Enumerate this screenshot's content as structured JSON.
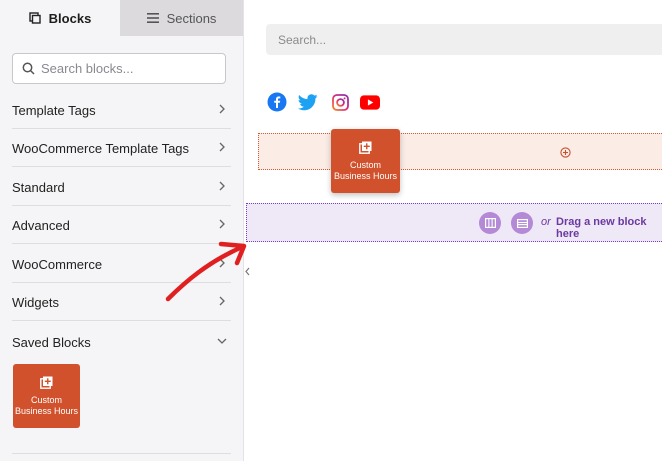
{
  "tabs": {
    "blocks_label": "Blocks",
    "sections_label": "Sections"
  },
  "sidebar": {
    "search_placeholder": "Search blocks...",
    "categories": [
      {
        "label": "Template Tags",
        "icon": "chevron-right-icon"
      },
      {
        "label": "WooCommerce Template Tags",
        "icon": "chevron-right-icon"
      },
      {
        "label": "Standard",
        "icon": "chevron-right-icon"
      },
      {
        "label": "Advanced",
        "icon": "chevron-right-icon"
      },
      {
        "label": "WooCommerce",
        "icon": "chevron-right-icon"
      },
      {
        "label": "Widgets",
        "icon": "chevron-right-icon"
      },
      {
        "label": "Saved Blocks",
        "icon": "chevron-down-icon"
      }
    ],
    "saved_block": {
      "label_line1": "Custom",
      "label_line2": "Business Hours"
    }
  },
  "canvas": {
    "search_placeholder": "Search...",
    "social_icons": [
      "facebook-icon",
      "twitter-icon",
      "instagram-icon",
      "youtube-icon"
    ],
    "dragging_block": {
      "label_line1": "Custom",
      "label_line2": "Business Hours"
    },
    "drop_zone": {
      "or_text": "or",
      "drag_text": "Drag a new block here"
    }
  },
  "colors": {
    "accent_orange": "#d1512c",
    "accent_purple": "#7b3fb5",
    "facebook": "#1877f2",
    "twitter": "#1da1f2",
    "instagram": "#e4405f",
    "youtube": "#ff0000",
    "annotation_arrow": "#e02020"
  }
}
